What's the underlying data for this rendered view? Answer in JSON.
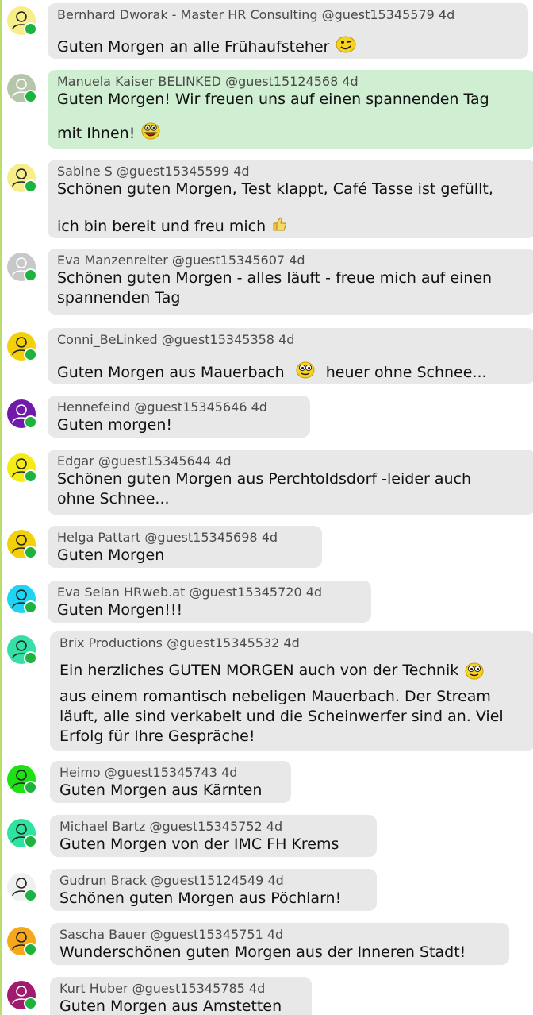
{
  "colors": {
    "online": "#1db33e",
    "bubble": "#e8e8e8",
    "highlight": "#cfeed2",
    "accent_bar": "#b9de6e"
  },
  "messages": [
    {
      "avatar_color": "#f7ee8a",
      "author": "Bernhard Dworak - Master HR Consulting",
      "handle": "@guest15345579",
      "age": "4d",
      "lines": [
        "Guten Morgen an alle Frühaufsteher"
      ],
      "emoji": "wink-emoji"
    },
    {
      "avatar_color": "#b6c6aa",
      "author": "Manuela Kaiser BELINKED",
      "handle": "@guest15124568",
      "age": "4d",
      "lines": [
        "Guten Morgen! Wir freuen uns auf einen spannenden Tag",
        "mit Ihnen!"
      ],
      "emoji": "grin-emoji"
    },
    {
      "avatar_color": "#f7ee8a",
      "author": "Sabine S",
      "handle": "@guest15345599",
      "age": "4d",
      "lines": [
        "Schönen guten Morgen, Test klappt, Café Tasse ist gefüllt,",
        "ich bin bereit und freu mich"
      ],
      "emoji": "thumbs-up-emoji"
    },
    {
      "avatar_color": "#c8c8c8",
      "author": "Eva Manzenreiter",
      "handle": "@guest15345607",
      "age": "4d",
      "lines": [
        "Schönen guten Morgen - alles läuft - freue mich auf einen",
        "spannenden Tag"
      ]
    },
    {
      "avatar_color": "#f2d10a",
      "author": "Conni_BeLinked",
      "handle": "@guest15345358",
      "age": "4d",
      "lines": [
        "Guten Morgen aus Mauerbach",
        "heuer ohne Schnee..."
      ],
      "emoji": "eyes-emoji"
    },
    {
      "avatar_color": "#6f1aa8",
      "author": "Hennefeind",
      "handle": "@guest15345646",
      "age": "4d",
      "lines": [
        "Guten morgen!"
      ]
    },
    {
      "avatar_color": "#f4ec14",
      "author": "Edgar",
      "handle": "@guest15345644",
      "age": "4d",
      "lines": [
        "Schönen guten Morgen aus Perchtoldsdorf -leider auch",
        "ohne Schnee..."
      ]
    },
    {
      "avatar_color": "#f2d10a",
      "author": "Helga Pattart",
      "handle": "@guest15345698",
      "age": "4d",
      "lines": [
        "Guten Morgen"
      ]
    },
    {
      "avatar_color": "#1fd3f2",
      "author": "Eva Selan HRweb.at",
      "handle": "@guest15345720",
      "age": "4d",
      "lines": [
        "Guten Morgen!!!"
      ]
    },
    {
      "avatar_color": "#34e0a6",
      "author": "Brix Productions",
      "handle": "@guest15345532",
      "age": "4d",
      "lines": [
        "Ein herzliches GUTEN MORGEN auch von der Technik",
        "aus einem romantisch nebeligen Mauerbach. Der Stream",
        "läuft, alle sind verkabelt und die Scheinwerfer sind an. Viel",
        "Erfolg für Ihre Gespräche!"
      ],
      "emoji": "eyes-emoji"
    },
    {
      "avatar_color": "#1ee014",
      "author": "Heimo",
      "handle": "@guest15345743",
      "age": "4d",
      "lines": [
        "Guten Morgen aus Kärnten"
      ]
    },
    {
      "avatar_color": "#2ee3a0",
      "author": "Michael Bartz",
      "handle": "@guest15345752",
      "age": "4d",
      "lines": [
        "Guten Morgen von der IMC FH Krems"
      ]
    },
    {
      "avatar_color": "#f0f0f0",
      "author": "Gudrun Brack",
      "handle": "@guest15124549",
      "age": "4d",
      "lines": [
        "Schönen guten Morgen aus Pöchlarn!"
      ]
    },
    {
      "avatar_color": "#f6a81c",
      "author": "Sascha Bauer",
      "handle": "@guest15345751",
      "age": "4d",
      "lines": [
        "Wunderschönen guten Morgen aus der Inneren Stadt!"
      ]
    },
    {
      "avatar_color": "#a01a6e",
      "author": "Kurt Huber",
      "handle": "@guest15345785",
      "age": "4d",
      "lines": [
        "Guten Morgen aus Amstetten"
      ]
    }
  ]
}
